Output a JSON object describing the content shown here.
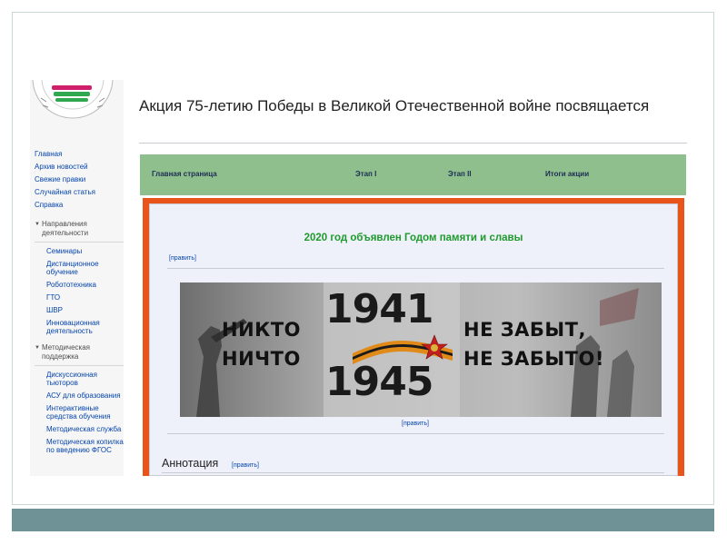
{
  "page": {
    "title": "Акция 75-летию Победы в Великой Отечественной войне посвящается"
  },
  "sidebar": {
    "nav": [
      {
        "label": "Главная"
      },
      {
        "label": "Архив новостей"
      },
      {
        "label": "Свежие правки"
      },
      {
        "label": "Случайная статья"
      },
      {
        "label": "Справка"
      }
    ],
    "portals": [
      {
        "heading": "Направления деятельности",
        "items": [
          {
            "label": "Семинары"
          },
          {
            "label": "Дистанционное обучение"
          },
          {
            "label": "Робототехника"
          },
          {
            "label": "ГТО"
          },
          {
            "label": "ШВР"
          },
          {
            "label": "Инновационная деятельность"
          }
        ]
      },
      {
        "heading": "Методическая поддержка",
        "items": [
          {
            "label": "Дискуссионная тьюторов"
          },
          {
            "label": "АСУ для образования"
          },
          {
            "label": "Интерактивные средства обучения"
          },
          {
            "label": "Методическая служба"
          },
          {
            "label": "Методическая копилка по введению ФГОС"
          }
        ]
      }
    ]
  },
  "topnav": {
    "items": [
      {
        "label": "Главная страница"
      },
      {
        "label": "Этап I"
      },
      {
        "label": "Этап II"
      },
      {
        "label": "Итоги акции"
      }
    ]
  },
  "content": {
    "announcement": "2020 год объявлен Годом памяти и славы",
    "edit_label": "[править]",
    "banner": {
      "left_top": "НИКТО",
      "left_bottom": "НИЧТО",
      "year_top": "1941",
      "year_bottom": "1945",
      "right_top": "НЕ ЗАБЫТ,",
      "right_bottom": "НЕ ЗАБЫТО!"
    },
    "section_heading": "Аннотация"
  },
  "colors": {
    "nav_bar": "#8fbf8c",
    "frame_orange": "#e8541a",
    "link_blue": "#0645ad",
    "headline_green": "#1f9a2c",
    "footer_band": "#6f9297"
  }
}
